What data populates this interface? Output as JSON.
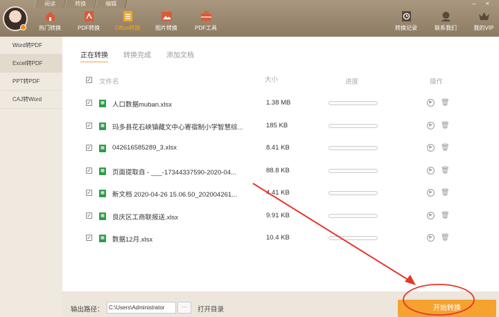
{
  "top_tabs": [
    "阅读",
    "转换",
    "编辑"
  ],
  "window_controls": "– ×",
  "toolbar": [
    {
      "label": "热门转换",
      "icon": "home-icon",
      "color": "#d95b3a"
    },
    {
      "label": "PDF转换",
      "icon": "pdf-icon",
      "color": "#d95b3a"
    },
    {
      "label": "Office转换",
      "icon": "office-icon",
      "color": "#f5a623"
    },
    {
      "label": "图片转换",
      "icon": "image-icon",
      "color": "#d95b3a"
    },
    {
      "label": "PDF工具",
      "icon": "toolbox-icon",
      "color": "#d95b3a"
    }
  ],
  "right_toolbar": [
    {
      "label": "转换记录",
      "icon": "history-icon"
    },
    {
      "label": "联系我们",
      "icon": "support-icon"
    },
    {
      "label": "我的VIP",
      "icon": "crown-icon"
    }
  ],
  "sidebar": [
    "Word转PDF",
    "Excel转PDF",
    "PPT转PDF",
    "CAJ转Word"
  ],
  "sub_tabs": [
    "正在转换",
    "转换完成",
    "添加文档"
  ],
  "table_header": {
    "check": "✓",
    "name": "文件名",
    "size": "大小",
    "progress": "进度",
    "actions": "操作"
  },
  "files": [
    {
      "name": "人口数据muban.xlsx",
      "size": "1.38 MB",
      "progress": 0
    },
    {
      "name": "玛多县花石峡镇藏文中心寄宿制小学智慧综...",
      "size": "185 KB",
      "progress": 0
    },
    {
      "name": "042616585289_3.xlsx",
      "size": "8.41 KB",
      "progress": 0
    },
    {
      "name": "页面提取自 - ___-17344337590-2020-04...",
      "size": "88.8 KB",
      "progress": 0
    },
    {
      "name": "新文档 2020-04-26 15.06.50_202004261...",
      "size": "4.41 KB",
      "progress": 0
    },
    {
      "name": "良庆区工商联报送.xlsx",
      "size": "9.91 KB",
      "progress": 0
    },
    {
      "name": "数据12月.xlsx",
      "size": "10.4 KB",
      "progress": 0
    }
  ],
  "footer": {
    "output_label": "输出路径：",
    "output_path": "C:\\Users\\Administrator",
    "browse": "···",
    "open_dir": "打开目录",
    "start": "开始转换"
  },
  "accent_color": "#f5a22f"
}
